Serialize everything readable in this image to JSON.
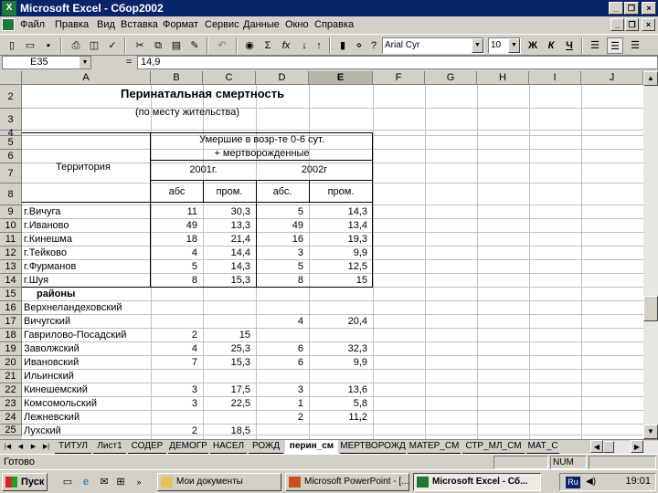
{
  "window": {
    "title": "Microsoft Excel - Сбор2002"
  },
  "menu": [
    "Файл",
    "Правка",
    "Вид",
    "Вставка",
    "Формат",
    "Сервис",
    "Данные",
    "Окно",
    "Справка"
  ],
  "toolbar": {
    "font": "Arial Cyr",
    "size": "10"
  },
  "formula": {
    "cell": "E35",
    "eq": "=",
    "value": "14,9"
  },
  "columns": [
    "A",
    "B",
    "C",
    "D",
    "E",
    "F",
    "G",
    "H",
    "I",
    "J"
  ],
  "rows": [
    "2",
    "3",
    "4",
    "5",
    "6",
    "7",
    "8",
    "9",
    "10",
    "11",
    "12",
    "13",
    "14",
    "15",
    "16",
    "17",
    "18",
    "19",
    "20",
    "21",
    "22",
    "23",
    "24",
    "25"
  ],
  "sheet": {
    "title": "Перинатальная смертность",
    "subtitle": "(по месту жительства)",
    "hdr_dead": "Умершие в возр-те 0-6 сут.",
    "hdr_still": "+ мертворожденные",
    "hdr_territory": "Территория",
    "hdr_2001": "2001г.",
    "hdr_2002": "2002г",
    "hdr_abs1": "абс",
    "hdr_prom1": "пром.",
    "hdr_abs2": "абс.",
    "hdr_prom2": "пром.",
    "section_districts": "районы",
    "data": [
      {
        "name": "г.Вичуга",
        "b": "11",
        "c": "30,3",
        "d": "5",
        "e": "14,3"
      },
      {
        "name": "г.Иваново",
        "b": "49",
        "c": "13,3",
        "d": "49",
        "e": "13,4"
      },
      {
        "name": "г.Кинешма",
        "b": "18",
        "c": "21,4",
        "d": "16",
        "e": "19,3"
      },
      {
        "name": "г.Тейково",
        "b": "4",
        "c": "14,4",
        "d": "3",
        "e": "9,9"
      },
      {
        "name": "г.Фурманов",
        "b": "5",
        "c": "14,3",
        "d": "5",
        "e": "12,5"
      },
      {
        "name": "г.Шуя",
        "b": "8",
        "c": "15,3",
        "d": "8",
        "e": "15"
      },
      {
        "name": "районы",
        "b": "",
        "c": "",
        "d": "",
        "e": ""
      },
      {
        "name": "Верхнеландеховский",
        "b": "",
        "c": "",
        "d": "",
        "e": ""
      },
      {
        "name": "Вичугский",
        "b": "",
        "c": "",
        "d": "4",
        "e": "20,4"
      },
      {
        "name": "Гаврилово-Посадский",
        "b": "2",
        "c": "15",
        "d": "",
        "e": ""
      },
      {
        "name": "Заволжский",
        "b": "4",
        "c": "25,3",
        "d": "6",
        "e": "32,3"
      },
      {
        "name": "Ивановский",
        "b": "7",
        "c": "15,3",
        "d": "6",
        "e": "9,9"
      },
      {
        "name": "Ильинский",
        "b": "",
        "c": "",
        "d": "",
        "e": ""
      },
      {
        "name": "Кинешемский",
        "b": "3",
        "c": "17,5",
        "d": "3",
        "e": "13,6"
      },
      {
        "name": "Комсомольский",
        "b": "3",
        "c": "22,5",
        "d": "1",
        "e": "5,8"
      },
      {
        "name": "Лежневский",
        "b": "",
        "c": "",
        "d": "2",
        "e": "11,2"
      },
      {
        "name": "Лухский",
        "b": "2",
        "c": "18,5",
        "d": "",
        "e": ""
      }
    ]
  },
  "tabs": [
    "ТИТУЛ",
    "Лист1",
    "СОДЕР",
    "ДЕМОГР",
    "НАСЕЛ",
    "РОЖД",
    "перин_см",
    "МЕРТВОРОЖД",
    "МАТЕР_СМ",
    "СТР_МЛ_СМ",
    "МАТ_С"
  ],
  "status": {
    "text": "Готово",
    "num": "NUM"
  },
  "taskbar": {
    "start": "Пуск",
    "tasks": [
      "Мои документы",
      "Microsoft PowerPoint - [...",
      "Microsoft Excel - Сб..."
    ],
    "lang": "Ru",
    "clock": "19:01"
  }
}
